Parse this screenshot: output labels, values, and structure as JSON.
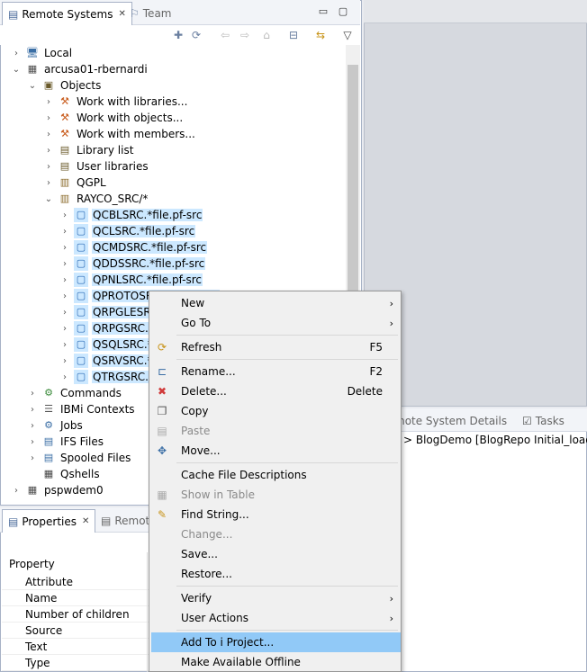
{
  "remote_systems": {
    "tab_label": "Remote Systems",
    "tab_close": "✕",
    "team_tab_label": "Team",
    "tree": [
      {
        "label": "Local",
        "twisty": ">",
        "indent": 0,
        "icon": "local-system-icon",
        "glyph": "🖥"
      },
      {
        "label": "arcusa01-rbernardi",
        "twisty": "v",
        "indent": 0,
        "icon": "ibm-i-system-icon",
        "glyph": "▦"
      },
      {
        "label": "Objects",
        "twisty": "v",
        "indent": 1,
        "icon": "objects-icon",
        "glyph": "▣"
      },
      {
        "label": "Work with libraries...",
        "twisty": ">",
        "indent": 2,
        "icon": "work-with-libraries-icon",
        "glyph": "⚒"
      },
      {
        "label": "Work with objects...",
        "twisty": ">",
        "indent": 2,
        "icon": "work-with-objects-icon",
        "glyph": "⚒"
      },
      {
        "label": "Work with members...",
        "twisty": ">",
        "indent": 2,
        "icon": "work-with-members-icon",
        "glyph": "⚒"
      },
      {
        "label": "Library list",
        "twisty": ">",
        "indent": 2,
        "icon": "library-list-icon",
        "glyph": "▤"
      },
      {
        "label": "User libraries",
        "twisty": ">",
        "indent": 2,
        "icon": "user-libraries-icon",
        "glyph": "▤"
      },
      {
        "label": "QGPL",
        "twisty": ">",
        "indent": 2,
        "icon": "library-icon",
        "glyph": "▥"
      },
      {
        "label": "RAYCO_SRC/*",
        "twisty": "v",
        "indent": 2,
        "icon": "filter-icon",
        "glyph": "▥"
      },
      {
        "label": "QCBLSRC.*file.pf-src",
        "twisty": ">",
        "indent": 3,
        "icon": "source-file-icon",
        "glyph": "▢",
        "selected": true
      },
      {
        "label": "QCLSRC.*file.pf-src",
        "twisty": ">",
        "indent": 3,
        "icon": "source-file-icon",
        "glyph": "▢",
        "selected": true
      },
      {
        "label": "QCMDSRC.*file.pf-src",
        "twisty": ">",
        "indent": 3,
        "icon": "source-file-icon",
        "glyph": "▢",
        "selected": true
      },
      {
        "label": "QDDSSRC.*file.pf-src",
        "twisty": ">",
        "indent": 3,
        "icon": "source-file-icon",
        "glyph": "▢",
        "selected": true
      },
      {
        "label": "QPNLSRC.*file.pf-src",
        "twisty": ">",
        "indent": 3,
        "icon": "source-file-icon",
        "glyph": "▢",
        "selected": true
      },
      {
        "label": "QPROTOSRC.*file.pf-src",
        "twisty": ">",
        "indent": 3,
        "icon": "source-file-icon",
        "glyph": "▢",
        "selected": true
      },
      {
        "label": "QRPGLESRC.*file.pf-src",
        "twisty": ">",
        "indent": 3,
        "icon": "source-file-icon",
        "glyph": "▢",
        "selected": true
      },
      {
        "label": "QRPGSRC.*file.pf-src",
        "twisty": ">",
        "indent": 3,
        "icon": "source-file-icon",
        "glyph": "▢",
        "selected": true
      },
      {
        "label": "QSQLSRC.*file.pf-src",
        "twisty": ">",
        "indent": 3,
        "icon": "source-file-icon",
        "glyph": "▢",
        "selected": true
      },
      {
        "label": "QSRVSRC.*file.pf-src",
        "twisty": ">",
        "indent": 3,
        "icon": "source-file-icon",
        "glyph": "▢",
        "selected": true
      },
      {
        "label": "QTRGSRC.*file.pf-src",
        "twisty": ">",
        "indent": 3,
        "icon": "source-file-icon",
        "glyph": "▢",
        "selected": true
      },
      {
        "label": "Commands",
        "twisty": ">",
        "indent": 1,
        "icon": "commands-icon",
        "glyph": "⚙"
      },
      {
        "label": "IBMi Contexts",
        "twisty": ">",
        "indent": 1,
        "icon": "contexts-icon",
        "glyph": "☰"
      },
      {
        "label": "Jobs",
        "twisty": ">",
        "indent": 1,
        "icon": "jobs-icon",
        "glyph": "⚙"
      },
      {
        "label": "IFS Files",
        "twisty": ">",
        "indent": 1,
        "icon": "ifs-files-icon",
        "glyph": "▤"
      },
      {
        "label": "Spooled Files",
        "twisty": ">",
        "indent": 1,
        "icon": "spooled-files-icon",
        "glyph": "▤"
      },
      {
        "label": "Qshells",
        "twisty": "",
        "indent": 1,
        "icon": "qshells-icon",
        "glyph": "▦"
      },
      {
        "label": "pspwdem0",
        "twisty": ">",
        "indent": 0,
        "icon": "ibm-i-system-icon",
        "glyph": "▦"
      }
    ]
  },
  "bottom_right": {
    "tab_remote_system_details": "mote System Details",
    "tab_tasks": "Tasks",
    "content": "> BlogDemo [BlogRepo Initial_load_of"
  },
  "properties": {
    "tab_label": "Properties",
    "tab_close": "✕",
    "remote_tab_label": "Remot",
    "header": "Property",
    "rows": [
      "Attribute",
      "Name",
      "Number of children",
      "Source",
      "Text",
      "Type"
    ]
  },
  "context_menu": [
    {
      "type": "item",
      "label": "New",
      "arrow": true,
      "icon": "",
      "glyph": ""
    },
    {
      "type": "item",
      "label": "Go To",
      "arrow": true,
      "icon": "",
      "glyph": ""
    },
    {
      "type": "sep"
    },
    {
      "type": "item",
      "label": "Refresh",
      "shortcut": "F5",
      "icon": "refresh-icon",
      "glyph": "⟳"
    },
    {
      "type": "sep"
    },
    {
      "type": "item",
      "label": "Rename...",
      "shortcut": "F2",
      "icon": "rename-icon",
      "glyph": "⊏"
    },
    {
      "type": "item",
      "label": "Delete...",
      "shortcut": "Delete",
      "icon": "delete-icon",
      "glyph": "✖"
    },
    {
      "type": "item",
      "label": "Copy",
      "icon": "copy-icon",
      "glyph": "❐"
    },
    {
      "type": "item",
      "label": "Paste",
      "disabled": true,
      "icon": "paste-icon",
      "glyph": "▤"
    },
    {
      "type": "item",
      "label": "Move...",
      "icon": "move-icon",
      "glyph": "✥"
    },
    {
      "type": "sep"
    },
    {
      "type": "item",
      "label": "Cache File Descriptions",
      "icon": "",
      "glyph": ""
    },
    {
      "type": "item",
      "label": "Show in Table",
      "disabled": true,
      "icon": "table-icon",
      "glyph": "▦"
    },
    {
      "type": "item",
      "label": "Find String...",
      "icon": "find-string-icon",
      "glyph": "✎"
    },
    {
      "type": "item",
      "label": "Change...",
      "disabled": true,
      "icon": "",
      "glyph": ""
    },
    {
      "type": "item",
      "label": "Save...",
      "icon": "",
      "glyph": ""
    },
    {
      "type": "item",
      "label": "Restore...",
      "icon": "",
      "glyph": ""
    },
    {
      "type": "sep"
    },
    {
      "type": "item",
      "label": "Verify",
      "arrow": true,
      "icon": "",
      "glyph": ""
    },
    {
      "type": "item",
      "label": "User Actions",
      "arrow": true,
      "icon": "",
      "glyph": ""
    },
    {
      "type": "sep"
    },
    {
      "type": "item",
      "label": "Add To i Project...",
      "highlighted": true,
      "icon": "",
      "glyph": ""
    },
    {
      "type": "item",
      "label": "Make Available Offline",
      "icon": "",
      "glyph": ""
    }
  ],
  "colors": {
    "selection": "#cce8ff",
    "menu_highlight": "#91c9f7",
    "panel_border": "#a7b2c6"
  }
}
